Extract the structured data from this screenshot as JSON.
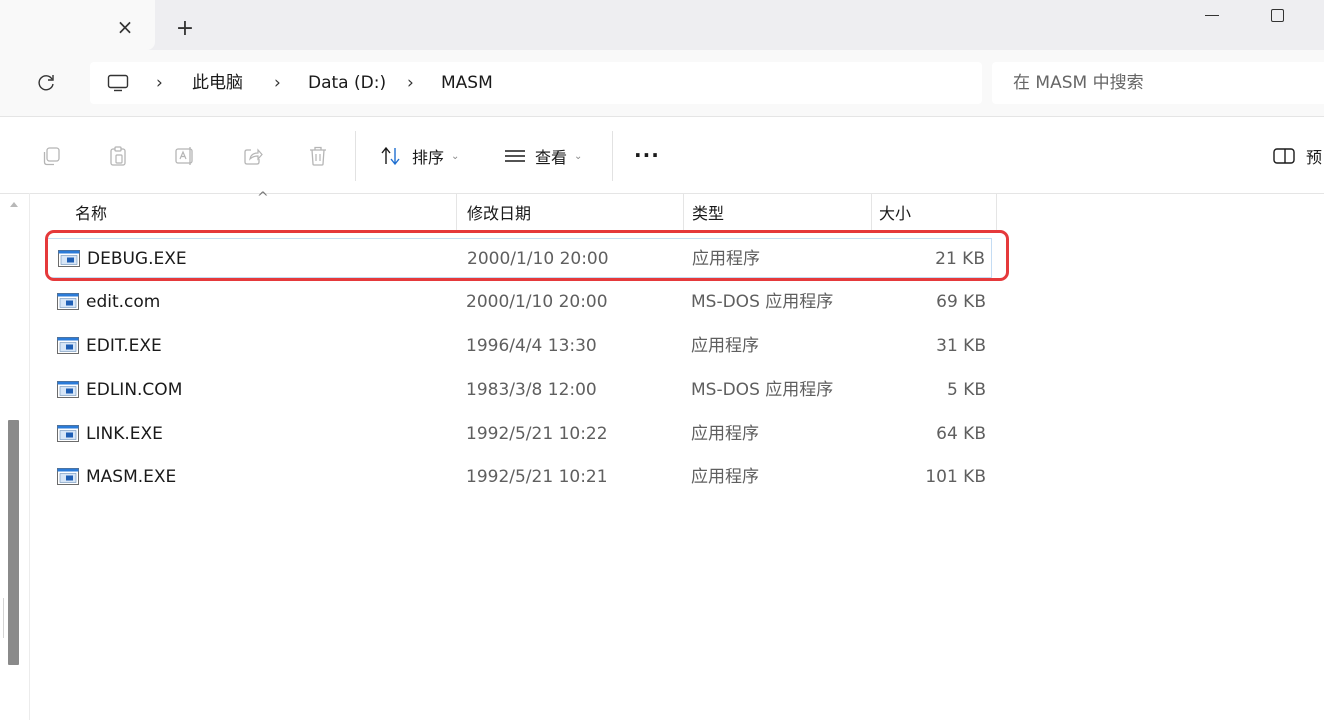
{
  "tab": {
    "close": "×",
    "new": "+"
  },
  "breadcrumb": [
    "此电脑",
    "Data (D:)",
    "MASM"
  ],
  "breadcrumb_sep": "›",
  "search": {
    "placeholder": "在 MASM 中搜索"
  },
  "toolbar": {
    "sort_label": "排序",
    "view_label": "查看",
    "more_label": "···",
    "preview_label": "预"
  },
  "columns": {
    "name": "名称",
    "date": "修改日期",
    "type": "类型",
    "size": "大小"
  },
  "files": [
    {
      "name": "DEBUG.EXE",
      "date": "2000/1/10 20:00",
      "type": "应用程序",
      "size": "21 KB"
    },
    {
      "name": "edit.com",
      "date": "2000/1/10 20:00",
      "type": "MS-DOS 应用程序",
      "size": "69 KB"
    },
    {
      "name": "EDIT.EXE",
      "date": "1996/4/4 13:30",
      "type": "应用程序",
      "size": "31 KB"
    },
    {
      "name": "EDLIN.COM",
      "date": "1983/3/8 12:00",
      "type": "MS-DOS 应用程序",
      "size": "5 KB"
    },
    {
      "name": "LINK.EXE",
      "date": "1992/5/21 10:22",
      "type": "应用程序",
      "size": "64 KB"
    },
    {
      "name": "MASM.EXE",
      "date": "1992/5/21 10:21",
      "type": "应用程序",
      "size": "101 KB"
    }
  ],
  "colors": {
    "highlight": "#e5393b",
    "selection_border": "#c4dcf3",
    "file_icon_blue": "#1f6fd0"
  }
}
